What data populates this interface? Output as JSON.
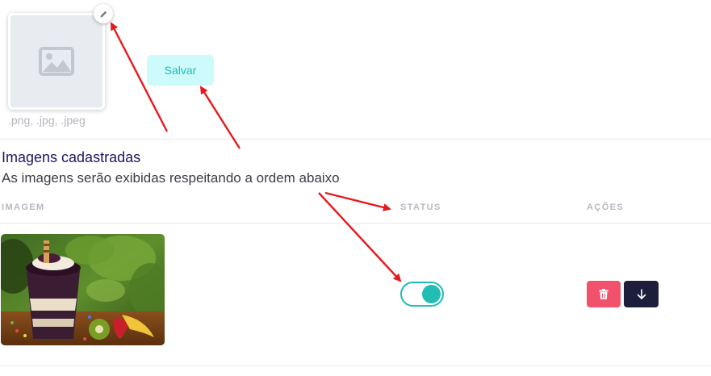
{
  "upload": {
    "hint": ".png, .jpg, .jpeg",
    "placeholder_icon": "image-placeholder-icon",
    "edit_icon": "pencil-icon",
    "save_label": "Salvar"
  },
  "section": {
    "title": "Imagens cadastradas",
    "subtitle": "As imagens serão exibidas respeitando a ordem abaixo"
  },
  "table": {
    "columns": [
      "IMAGEM",
      "STATUS",
      "AÇÕES"
    ],
    "rows": [
      {
        "image": "acai-cup-photo",
        "status_active": true,
        "actions": [
          "trash-icon",
          "arrow-down-icon"
        ]
      }
    ]
  },
  "colors": {
    "accent": "#22bdb5",
    "save_bg": "#cdfbfb",
    "delete": "#f2516b",
    "move": "#1c1e3b",
    "title": "#1d1560",
    "annotation": "#e8191c"
  }
}
